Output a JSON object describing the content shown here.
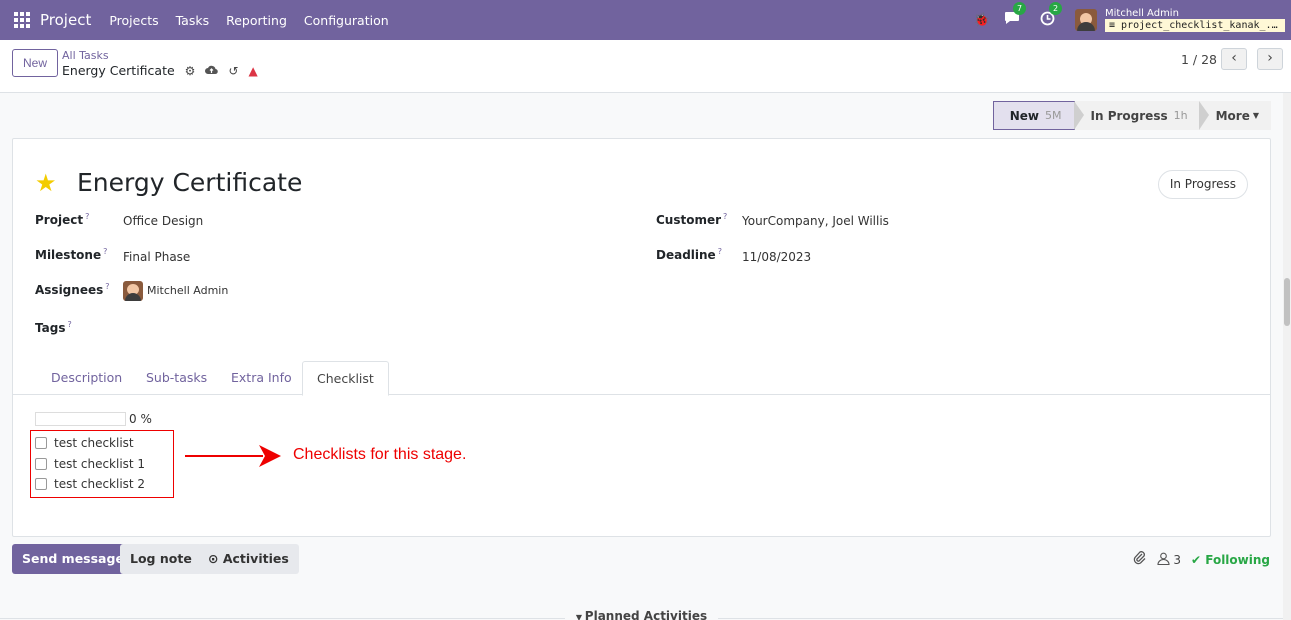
{
  "navbar": {
    "app_name": "Project",
    "menu": [
      "Projects",
      "Tasks",
      "Reporting",
      "Configuration"
    ],
    "messages_badge": "7",
    "activities_badge": "2",
    "user_name": "Mitchell Admin",
    "database": "project_checklist_kanak_..."
  },
  "control": {
    "new_label": "New",
    "breadcrumb": "All Tasks",
    "record_name": "Energy Certificate",
    "pager": "1 / 28"
  },
  "statusbar": {
    "stages": [
      {
        "label": "New",
        "duration": "5M"
      },
      {
        "label": "In Progress",
        "duration": "1h"
      },
      {
        "label": "More"
      }
    ]
  },
  "form": {
    "title": "Energy Certificate",
    "kanban_state": "In Progress",
    "fields": {
      "project": {
        "label": "Project",
        "value": "Office Design"
      },
      "milestone": {
        "label": "Milestone",
        "value": "Final Phase"
      },
      "assignees": {
        "label": "Assignees",
        "value": "Mitchell Admin"
      },
      "tags": {
        "label": "Tags",
        "value": ""
      },
      "customer": {
        "label": "Customer",
        "value": "YourCompany, Joel Willis"
      },
      "deadline": {
        "label": "Deadline",
        "value": "11/08/2023"
      }
    },
    "tabs": [
      "Description",
      "Sub-tasks",
      "Extra Info",
      "Checklist"
    ],
    "active_tab": "Checklist",
    "checklist": {
      "progress_percent": 0,
      "progress_text": "0 %",
      "items": [
        "test checklist",
        "test checklist 1",
        "test checklist 2"
      ]
    },
    "annotation": "Checklists for this stage."
  },
  "chatter": {
    "send_message": "Send message",
    "log_note": "Log note",
    "activities": "Activities",
    "followers_count": "3",
    "following": "Following",
    "planned_activities": "Planned Activities"
  },
  "colors": {
    "brand": "#71639e",
    "annotation": "#ee0000",
    "star": "#f3cc00",
    "following": "#28a745"
  }
}
